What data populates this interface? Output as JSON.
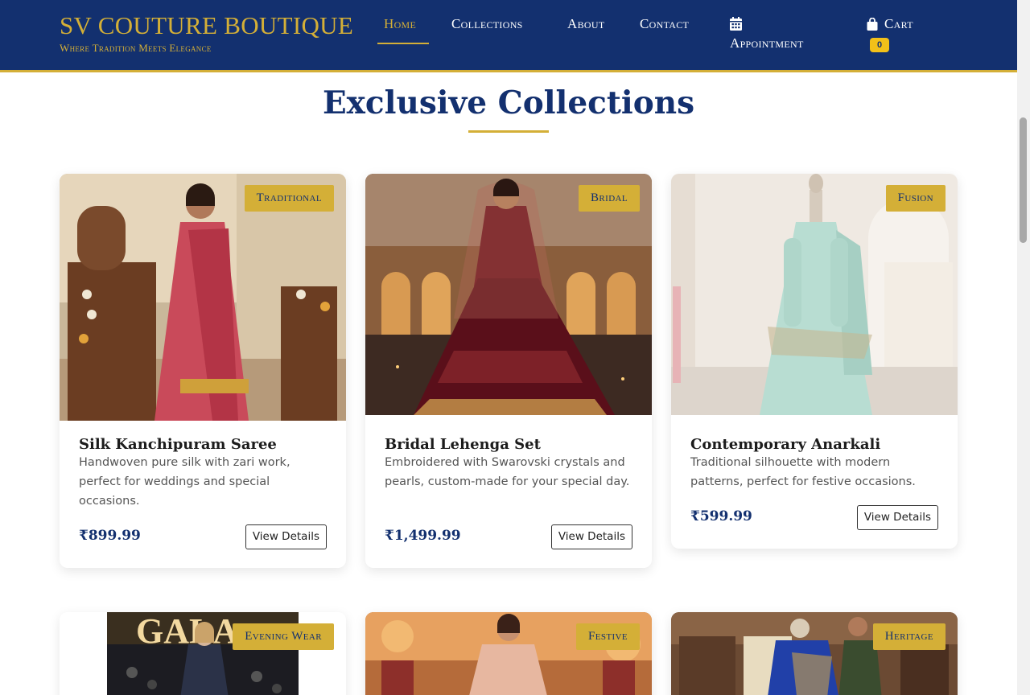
{
  "header": {
    "brand_name": "SV COUTURE BOUTIQUE",
    "brand_tagline": "Where Tradition Meets Elegance",
    "nav": [
      {
        "label": "Home",
        "active": true
      },
      {
        "label": "Collections"
      },
      {
        "label": "About"
      },
      {
        "label": "Contact"
      },
      {
        "label": "Appointment",
        "icon": "calendar-icon"
      },
      {
        "label": "Cart",
        "icon": "shopping-bag-icon"
      }
    ],
    "cart_count": "0"
  },
  "section": {
    "title": "Exclusive Collections"
  },
  "products": [
    {
      "badge": "Traditional",
      "title": "Silk Kanchipuram Saree",
      "description": "Handwoven pure silk with zari work, perfect for weddings and special occasions.",
      "price": "₹899.99",
      "button": "View Details"
    },
    {
      "badge": "Bridal",
      "title": "Bridal Lehenga Set",
      "description": "Embroidered with Swarovski crystals and pearls, custom-made for your special day.",
      "price": "₹1,499.99",
      "button": "View Details"
    },
    {
      "badge": "Fusion",
      "title": "Contemporary Anarkali",
      "description": "Traditional silhouette with modern patterns, perfect for festive occasions.",
      "price": "₹599.99",
      "button": "View Details"
    },
    {
      "badge": "Evening Wear"
    },
    {
      "badge": "Festive"
    },
    {
      "badge": "Heritage"
    }
  ],
  "colors": {
    "navy": "#13306f",
    "gold": "#d4af37",
    "badge_yellow": "#f2c019"
  }
}
